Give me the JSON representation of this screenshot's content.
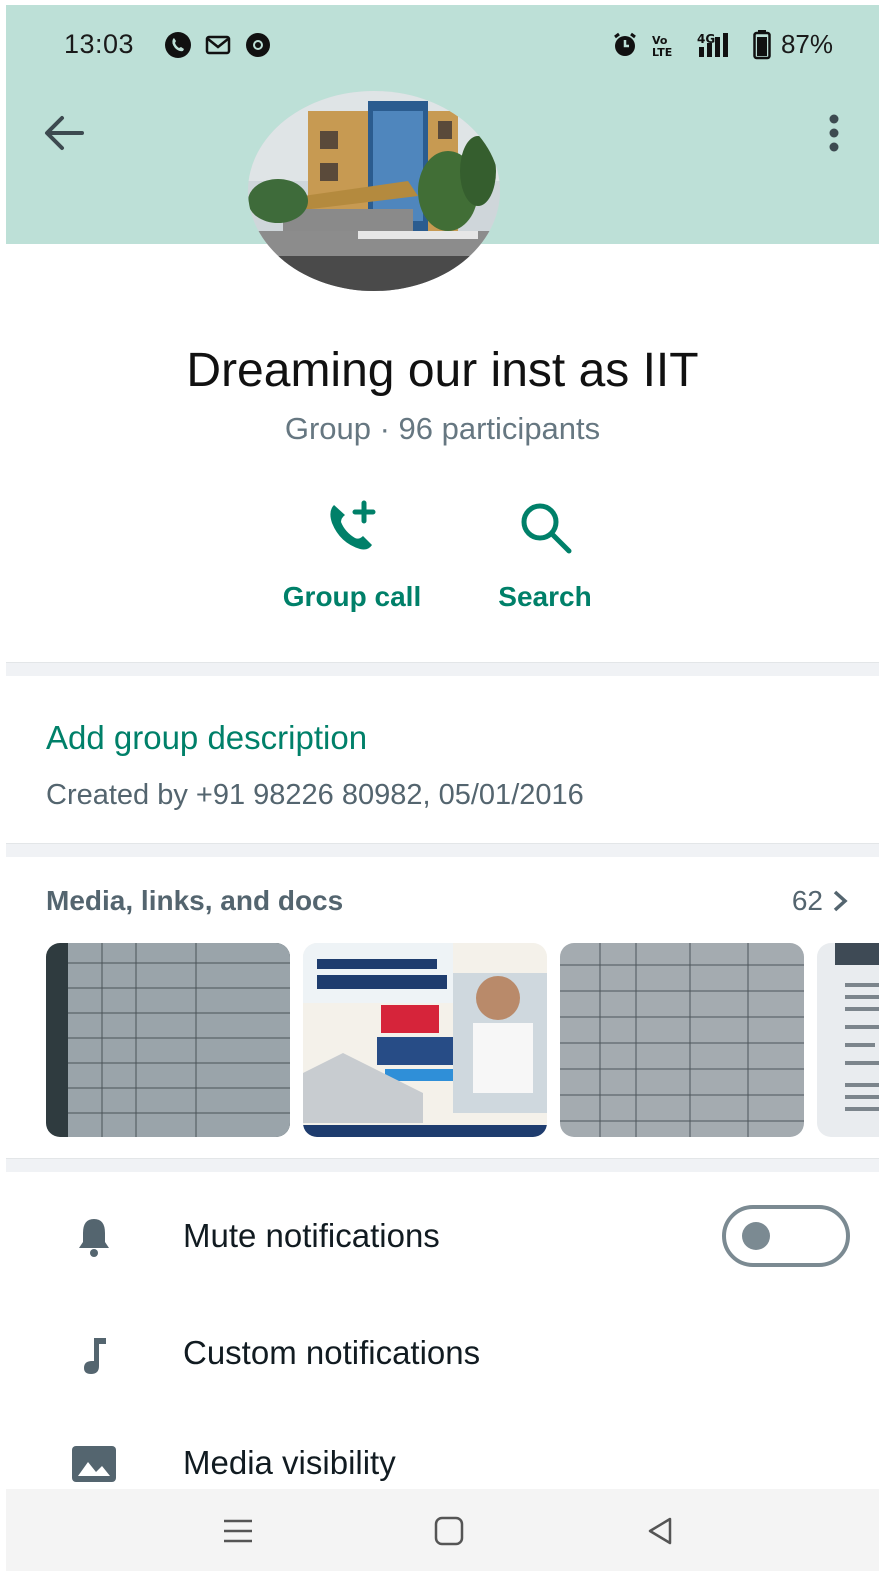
{
  "status_bar": {
    "time": "13:03",
    "left_icons": [
      "whatsapp-icon",
      "gmail-icon",
      "chrome-icon"
    ],
    "right_icons": [
      "alarm-icon",
      "volte-icon",
      "signal-4g-icon",
      "battery-icon"
    ],
    "battery": "87%"
  },
  "header": {
    "back_icon": "arrow-left-icon",
    "menu_icon": "more-vertical-icon",
    "background_color": "#bde0d7"
  },
  "group": {
    "title": "Dreaming our inst as IIT",
    "subtitle": "Group · 96 participants"
  },
  "actions": [
    {
      "label": "Group call",
      "icon": "add-call-icon"
    },
    {
      "label": "Search",
      "icon": "search-icon"
    }
  ],
  "description": {
    "add_label": "Add group description",
    "created": "Created by +91 98226 80982, 05/01/2016"
  },
  "media": {
    "heading": "Media, links, and docs",
    "count": "62"
  },
  "settings": [
    {
      "label": "Mute notifications",
      "icon": "bell-icon"
    },
    {
      "label": "Custom notifications",
      "icon": "music-note-icon"
    },
    {
      "label": "Media visibility",
      "icon": "image-icon"
    }
  ],
  "accent_color": "#008069"
}
